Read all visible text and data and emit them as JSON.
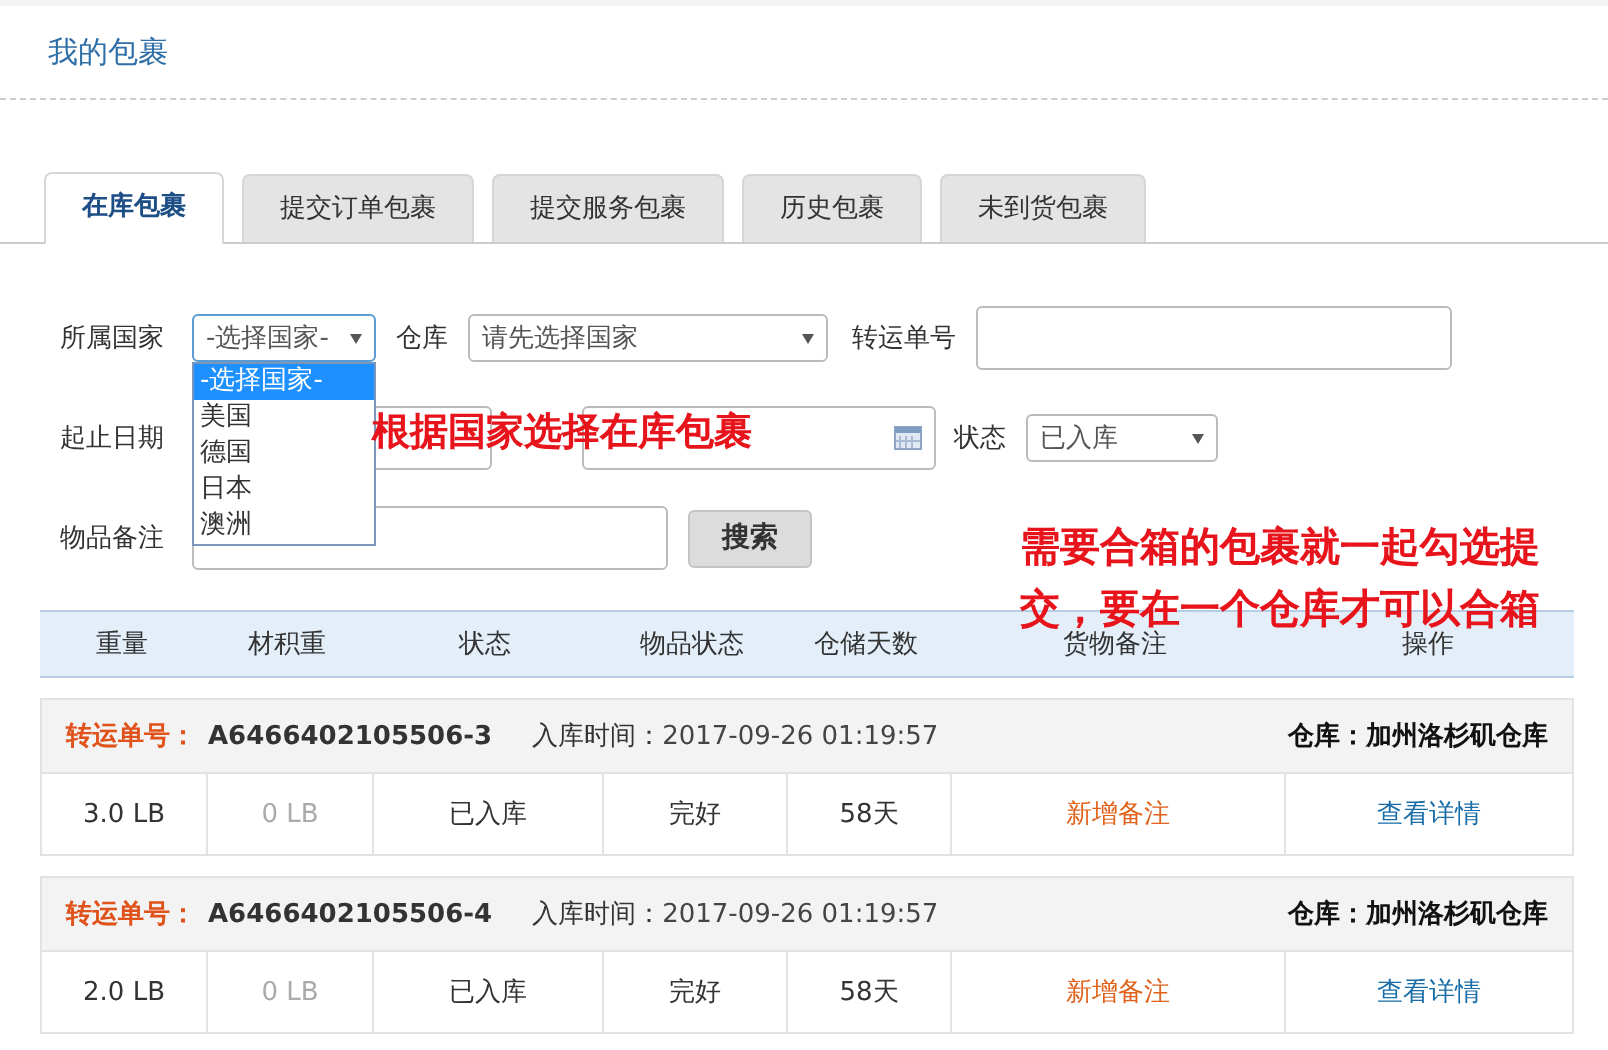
{
  "page_title": "我的包裹",
  "tabs": [
    {
      "label": "在库包裹",
      "selected": true
    },
    {
      "label": "提交订单包裹",
      "selected": false
    },
    {
      "label": "提交服务包裹",
      "selected": false
    },
    {
      "label": "历史包裹",
      "selected": false
    },
    {
      "label": "未到货包裹",
      "selected": false
    }
  ],
  "filters": {
    "country": {
      "label": "所属国家",
      "value": "-选择国家-",
      "expanded": true,
      "options": [
        {
          "label": "-选择国家-",
          "selected": true
        },
        {
          "label": "美国",
          "selected": false
        },
        {
          "label": "德国",
          "selected": false
        },
        {
          "label": "日本",
          "selected": false
        },
        {
          "label": "澳洲",
          "selected": false
        }
      ]
    },
    "warehouse": {
      "label": "仓库",
      "value": "请先选择国家"
    },
    "tracking": {
      "label": "转运单号"
    },
    "date": {
      "label": "起止日期"
    },
    "status": {
      "label": "状态",
      "value": "已入库"
    },
    "note": {
      "label": "物品备注"
    },
    "search_button": "搜索"
  },
  "annotations": [
    "根据国家选择在库包裹",
    "需要合箱的包裹就一起勾选提交，要在一个仓库才可以合箱"
  ],
  "table": {
    "columns": [
      "重量",
      "材积重",
      "状态",
      "物品状态",
      "仓储天数",
      "货物备注",
      "操作"
    ],
    "packages": [
      {
        "tracking_label": "转运单号：",
        "tracking_no": "A6466402105506-3",
        "time_label": "入库时间：",
        "time": "2017-09-26 01:19:57",
        "warehouse": "仓库：加州洛杉矶仓库",
        "weight": "3.0 LB",
        "volume_weight": "0 LB",
        "status": "已入库",
        "condition": "完好",
        "days": "58天",
        "note_link": "新增备注",
        "detail_link": "查看详情"
      },
      {
        "tracking_label": "转运单号：",
        "tracking_no": "A6466402105506-4",
        "time_label": "入库时间：",
        "time": "2017-09-26 01:19:57",
        "warehouse": "仓库：加州洛杉矶仓库",
        "weight": "2.0 LB",
        "volume_weight": "0 LB",
        "status": "已入库",
        "condition": "完好",
        "days": "58天",
        "note_link": "新增备注",
        "detail_link": "查看详情"
      }
    ]
  }
}
